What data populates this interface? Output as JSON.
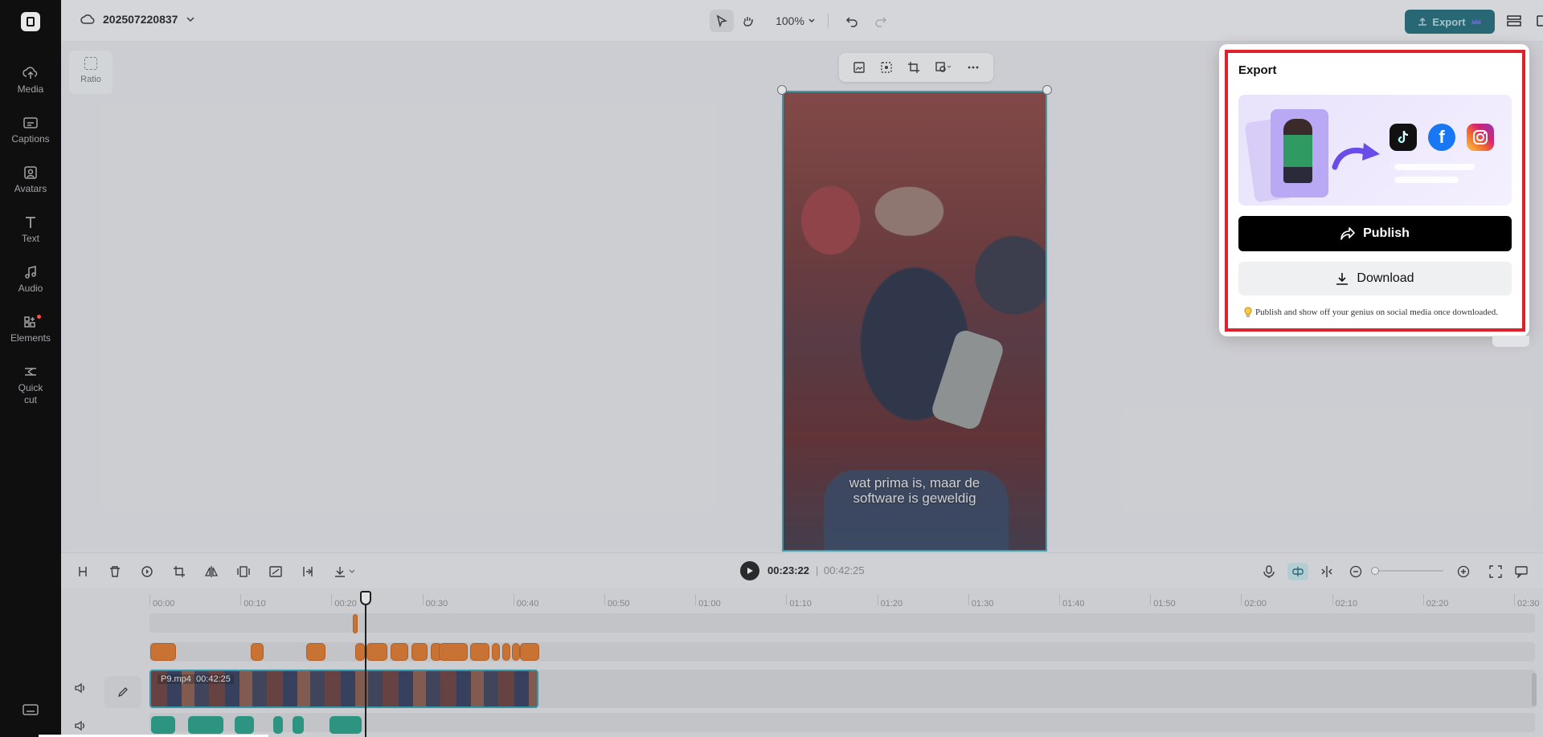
{
  "app": {
    "project_name": "202507220837",
    "zoom": "100%",
    "export_label": "Export"
  },
  "sidebar": {
    "items": [
      {
        "label": "Media",
        "icon": "cloud-upload-icon"
      },
      {
        "label": "Captions",
        "icon": "captions-icon"
      },
      {
        "label": "Avatars",
        "icon": "avatar-icon"
      },
      {
        "label": "Text",
        "icon": "text-icon"
      },
      {
        "label": "Audio",
        "icon": "music-note-icon"
      },
      {
        "label": "Elements",
        "icon": "elements-icon"
      },
      {
        "label": "Quick cut",
        "icon": "quick-cut-icon"
      }
    ]
  },
  "canvas": {
    "ratio_label": "Ratio",
    "subtitle_line1": "wat prima is, maar de",
    "subtitle_line2": "software is geweldig"
  },
  "export_panel": {
    "title": "Export",
    "publish_label": "Publish",
    "download_label": "Download",
    "tip": "Publish and show off your genius on social media once downloaded.",
    "social": [
      "tiktok-icon",
      "facebook-icon",
      "instagram-icon"
    ]
  },
  "timeline": {
    "current_time": "00:23:22",
    "separator": "|",
    "total_time": "00:42:25",
    "ruler_labels": [
      "00:00",
      "00:10",
      "00:20",
      "00:30",
      "00:40",
      "00:50",
      "01:00",
      "01:10",
      "01:20",
      "01:30",
      "01:40",
      "01:50",
      "02:00",
      "02:10",
      "02:20",
      "02:30"
    ],
    "clip_name": "P9.mp4",
    "clip_duration": "00:42:25"
  },
  "colors": {
    "accent": "#1d6a76",
    "highlight": "#e0202a",
    "caption_clip": "#e07626",
    "audio_clip": "#219f84",
    "selection": "#2aa5b8"
  }
}
